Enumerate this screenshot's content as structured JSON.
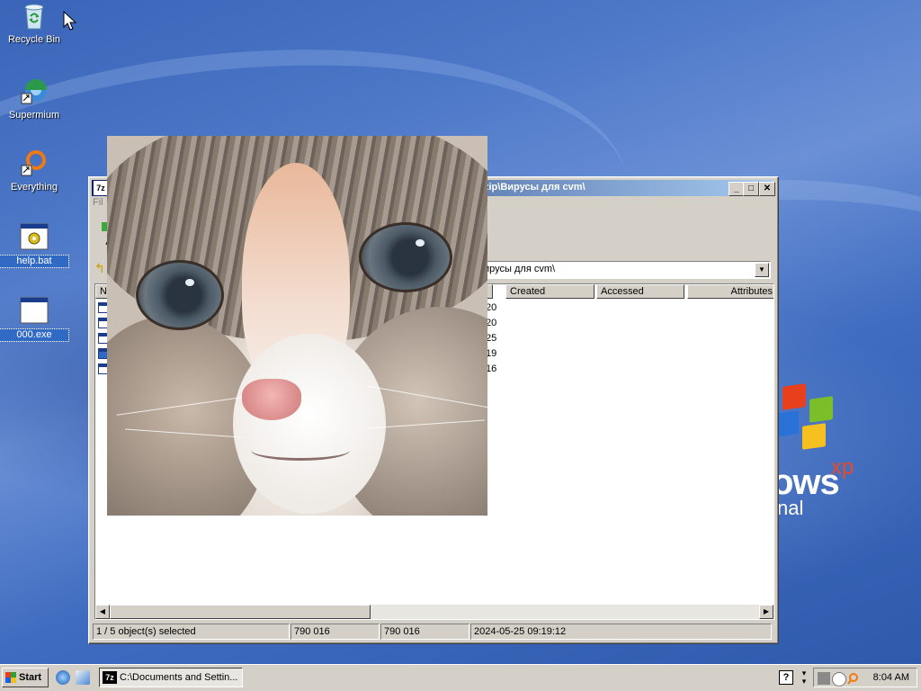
{
  "desktop": {
    "icons": [
      {
        "label": "Recycle Bin"
      },
      {
        "label": "Supermium"
      },
      {
        "label": "Everything"
      },
      {
        "label": "help.bat"
      },
      {
        "label": "000.exe"
      }
    ],
    "os_logo": {
      "word": "ows",
      "sup": "xp",
      "edition": "nal"
    }
  },
  "window": {
    "title_prefix": "7z",
    "title": "zip\\Вирусы для cvm\\",
    "menu": [
      "Fil"
    ],
    "toolbar": {
      "add_label": "A"
    },
    "address": "ирусы для cvm\\",
    "columns": [
      "Na",
      "Created",
      "Accessed",
      "Attributes"
    ],
    "rows": [
      {
        "time": ":20",
        "selected": false
      },
      {
        "time": ":20",
        "selected": false
      },
      {
        "time": ":25",
        "selected": false
      },
      {
        "time": ":19",
        "selected": true
      },
      {
        "time": ":16",
        "selected": false
      }
    ],
    "status": {
      "selection": "1 / 5 object(s) selected",
      "size": "790 016",
      "packed": "790 016",
      "modified": "2024-05-25 09:19:12"
    }
  },
  "taskbar": {
    "start_label": "Start",
    "task_icon": "7z",
    "task_label": "C:\\Documents and Settin...",
    "help": "?",
    "clock": "8:04 AM"
  }
}
